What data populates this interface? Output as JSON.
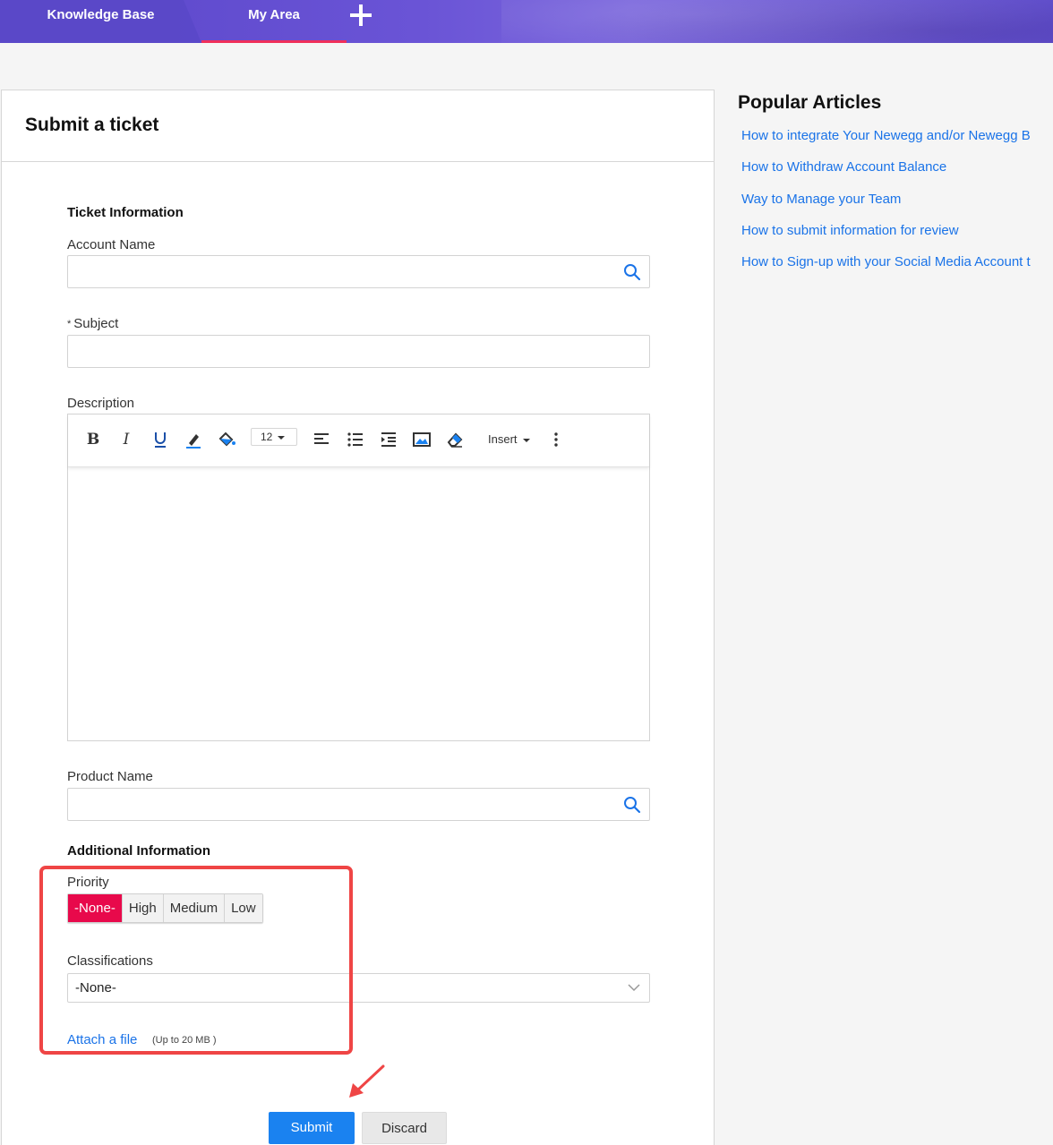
{
  "nav": {
    "tabs": [
      {
        "label": "Knowledge Base"
      },
      {
        "label": "My Area",
        "active": true
      }
    ],
    "add_icon": "plus-icon",
    "colors": {
      "bar": "#6452cf",
      "active_underline": "#ef2f5b"
    }
  },
  "card": {
    "title": "Submit a ticket"
  },
  "form": {
    "ticket_info_title": "Ticket Information",
    "account_name_label": "Account Name",
    "subject_required_mark": "*",
    "subject_label": "Subject",
    "description_label": "Description",
    "editor": {
      "font_size": "12",
      "insert_label": "Insert",
      "tools": [
        "bold-icon",
        "italic-icon",
        "underline-icon",
        "text-color-icon",
        "fill-color-icon",
        "font-size-select",
        "align-left-icon",
        "bullet-list-icon",
        "indent-icon",
        "image-icon",
        "eraser-icon",
        "insert-menu",
        "more-icon"
      ]
    },
    "product_name_label": "Product Name",
    "additional_info_title": "Additional Information",
    "priority_label": "Priority",
    "priority_options": [
      "-None-",
      "High",
      "Medium",
      "Low"
    ],
    "priority_selected": "-None-",
    "classifications_label": "Classifications",
    "classifications_value": "-None-",
    "attach_label": "Attach a file",
    "attach_note": "(Up to 20 MB )",
    "submit_label": "Submit",
    "discard_label": "Discard",
    "colors": {
      "primary": "#1a82f0",
      "priority_active": "#e8094b",
      "link": "#1a73e8",
      "annotation": "#ef4545"
    }
  },
  "sidebar": {
    "title": "Popular Articles",
    "articles": [
      "How to integrate Your Newegg and/or Newegg B",
      "How to Withdraw Account Balance",
      "Way to Manage your Team",
      "How to submit information for review",
      "How to Sign-up with your Social Media Account t"
    ]
  }
}
